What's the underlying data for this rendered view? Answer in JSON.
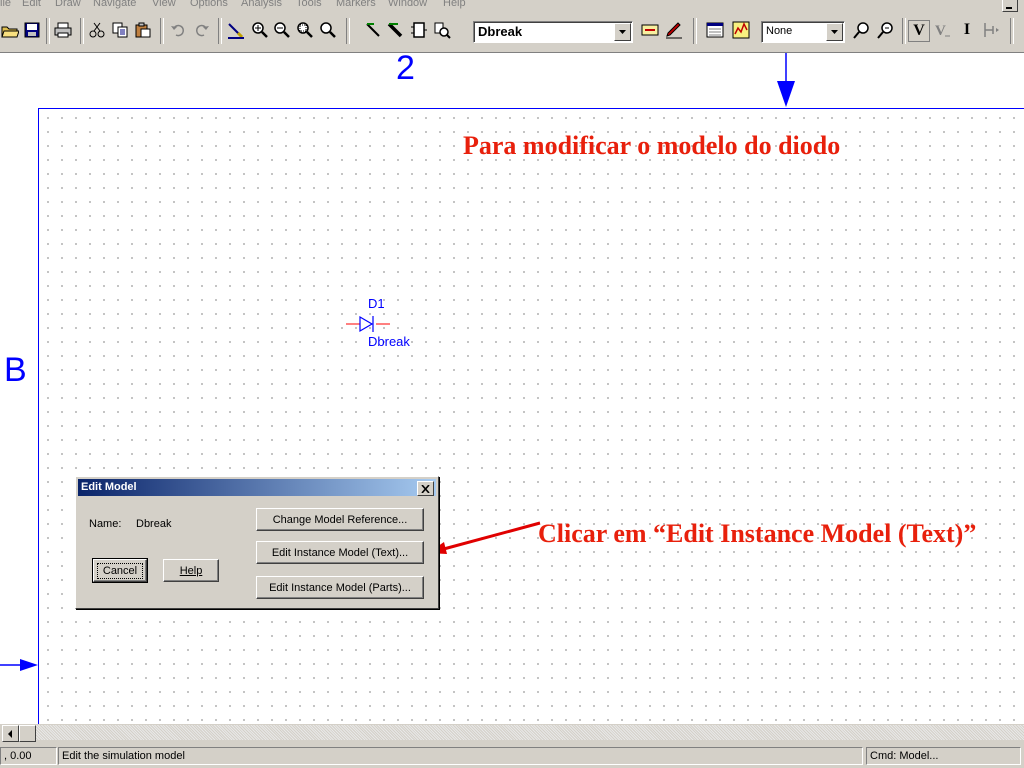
{
  "menu": {
    "items": [
      "ile",
      "Edit",
      "Draw",
      "Navigate",
      "View",
      "Options",
      "Analysis",
      "Tools",
      "Markers",
      "Window",
      "Help"
    ]
  },
  "toolbar": {
    "part_combo_value": "Dbreak",
    "grid_combo_value": "None",
    "icons": [
      "open-icon",
      "save-icon",
      "print-icon",
      "cut-icon",
      "copy-icon",
      "paste-icon",
      "undo-icon",
      "redo-icon",
      "draw-wire-icon",
      "zoom-in-icon",
      "zoom-out-icon",
      "zoom-area-icon",
      "zoom-fit-icon",
      "wire-icon",
      "bus-icon",
      "block-icon",
      "get-part-icon",
      "edit-attributes-icon",
      "edit-symbol-icon",
      "setup-analysis-icon",
      "simulate-icon",
      "probe-icon",
      "probe-add-icon",
      "voltage-marker-icon",
      "voltage-diff-icon",
      "current-marker-icon",
      "enable-bias-icon"
    ],
    "marker_v": "V",
    "marker_i": "I"
  },
  "schematic": {
    "zone_top": "2",
    "zone_left": "B",
    "component_ref": "D1",
    "component_model": "Dbreak",
    "colors": {
      "wire": "#0000ff",
      "annotation": "#e8200c"
    }
  },
  "annotations": {
    "title": "Para modificar o modelo do diodo",
    "instruction": "Clicar em “Edit Instance Model (Text)”"
  },
  "dialog": {
    "title": "Edit Model",
    "name_label": "Name:",
    "name_value": "Dbreak",
    "change_reference": "Change Model Reference...",
    "edit_instance_text": "Edit Instance Model (Text)...",
    "edit_instance_parts": "Edit Instance Model (Parts)...",
    "cancel": "Cancel",
    "help": "Help"
  },
  "status": {
    "coords": ", 0.00",
    "message": "Edit the simulation model",
    "command": "Cmd: Model..."
  }
}
